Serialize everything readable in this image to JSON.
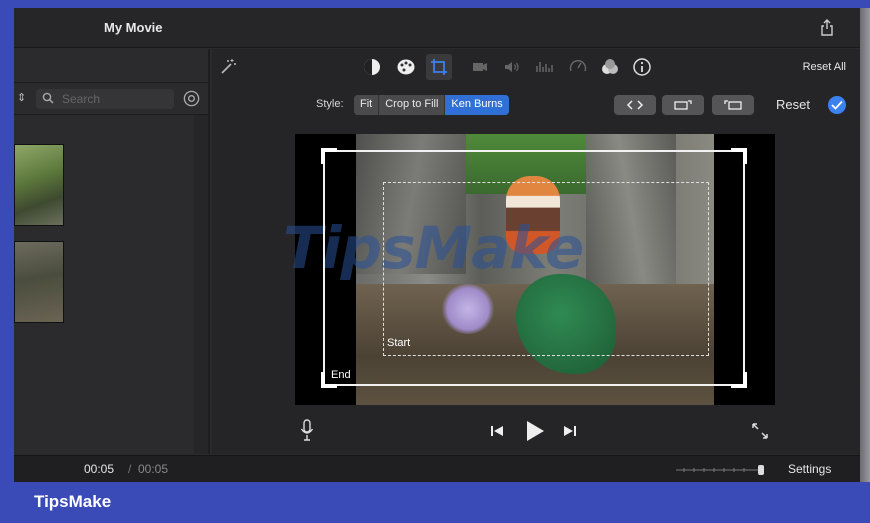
{
  "window": {
    "title": "My Movie"
  },
  "library": {
    "search_placeholder": "Search"
  },
  "toolbar": {
    "icons": [
      "magic-wand-icon",
      "color-balance-icon",
      "color-palette-icon",
      "crop-icon",
      "stabilization-icon",
      "volume-icon",
      "equalizer-icon",
      "speed-icon",
      "filter-icon",
      "info-icon"
    ],
    "reset_all_label": "Reset All"
  },
  "style": {
    "label": "Style:",
    "options": [
      "Fit",
      "Crop to Fill",
      "Ken Burns"
    ],
    "selected": "Ken Burns",
    "reset_label": "Reset"
  },
  "preview": {
    "start_label": "Start",
    "end_label": "End",
    "watermark": "TipsMake"
  },
  "timeline": {
    "current_time": "00:05",
    "separator": "/",
    "total_time": "00:05",
    "settings_label": "Settings"
  },
  "brand": {
    "name": "TipsMake"
  },
  "colors": {
    "accent": "#2f6fd6",
    "frame_bg": "#3a4bb8"
  }
}
